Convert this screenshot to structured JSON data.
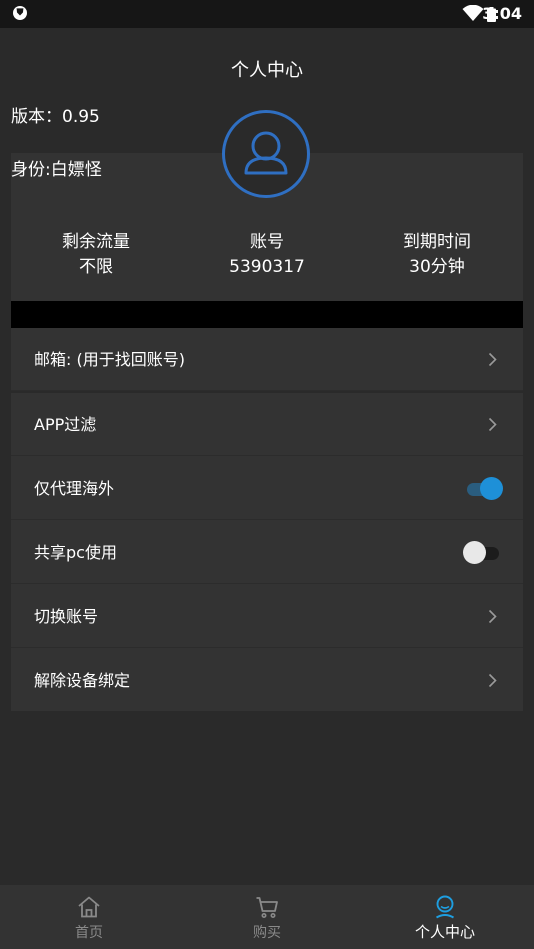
{
  "status_bar": {
    "time": "3:04",
    "app_icon": "shield-icon",
    "wifi_icon": "wifi-icon",
    "battery_icon": "battery-icon"
  },
  "header": {
    "title": "个人中心"
  },
  "profile": {
    "version": "版本：0.95",
    "identity": "身份:白嫖怪",
    "avatar_icon": "user-icon",
    "stats": [
      {
        "label": "剩余流量",
        "value": "不限"
      },
      {
        "label": "账号",
        "value": "5390317"
      },
      {
        "label": "到期时间",
        "value": "30分钟"
      }
    ]
  },
  "menu": {
    "email": "邮箱: (用于找回账号)",
    "app_filter": "APP过滤",
    "overseas_only": {
      "label": "仅代理海外",
      "enabled": true
    },
    "share_pc": {
      "label": "共享pc使用",
      "enabled": false
    },
    "switch_account": "切换账号",
    "unbind_device": "解除设备绑定"
  },
  "bottom_nav": [
    {
      "label": "首页",
      "icon": "home-icon",
      "active": false
    },
    {
      "label": "购买",
      "icon": "cart-icon",
      "active": false
    },
    {
      "label": "个人中心",
      "icon": "user-icon",
      "active": true
    }
  ],
  "colors": {
    "accent": "#1e90d8",
    "avatar_ring": "#2f6fc2",
    "background": "#2a2a2a",
    "card": "#333333"
  }
}
